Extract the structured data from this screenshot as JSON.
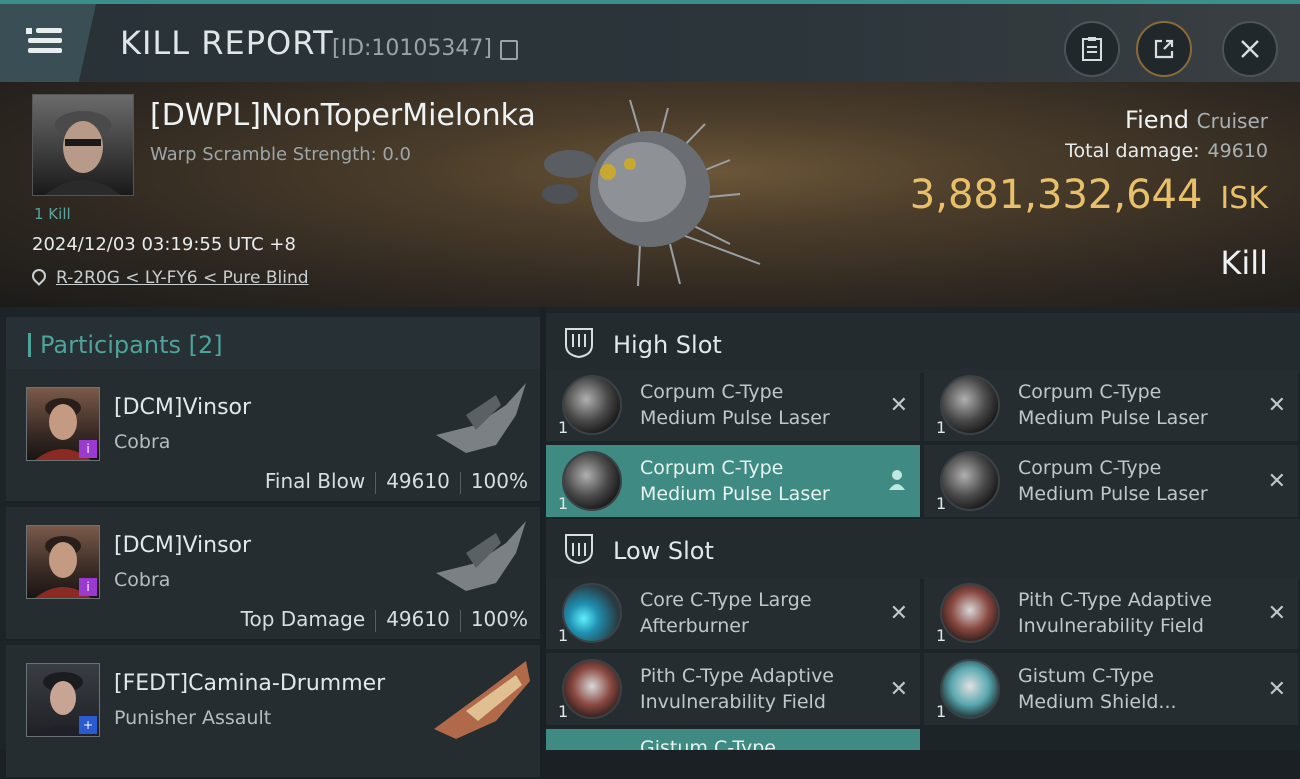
{
  "header": {
    "title": "KILL REPORT",
    "kill_id": "[ID:10105347]",
    "buttons": [
      "clipboard-icon",
      "share-icon",
      "close-icon"
    ]
  },
  "victim": {
    "name": "[DWPL]NonToperMielonka",
    "warp_scramble": "Warp Scramble Strength: 0.0",
    "kills": "1 Kill",
    "timestamp": "2024/12/03 03:19:55 UTC +8",
    "location": "R-2R0G < LY-FY6 < Pure Blind",
    "ship_name": "Fiend",
    "ship_class": "Cruiser",
    "total_damage_label": "Total damage:",
    "total_damage": "49610",
    "isk_value": "3,881,332,644",
    "isk_unit": "ISK",
    "result": "Kill"
  },
  "participants": {
    "header": "Participants [2]",
    "items": [
      {
        "name": "[DCM]Vinsor",
        "ship": "Cobra",
        "role": "Final Blow",
        "damage": "49610",
        "percent": "100%",
        "badge": "i"
      },
      {
        "name": "[DCM]Vinsor",
        "ship": "Cobra",
        "role": "Top Damage",
        "damage": "49610",
        "percent": "100%",
        "badge": "i"
      },
      {
        "name": "[FEDT]Camina-Drummer",
        "ship": "Punisher Assault",
        "badge": "+"
      }
    ]
  },
  "fittings": {
    "high_slot": {
      "label": "High Slot",
      "modules": [
        {
          "line1": "Corpum C-Type",
          "line2": "Medium Pulse Laser",
          "qty": "1"
        },
        {
          "line1": "Corpum C-Type",
          "line2": "Medium Pulse Laser",
          "qty": "1"
        },
        {
          "line1": "Corpum C-Type",
          "line2": "Medium Pulse Laser",
          "qty": "1"
        },
        {
          "line1": "Corpum C-Type",
          "line2": "Medium Pulse Laser",
          "qty": "1"
        }
      ]
    },
    "low_slot": {
      "label": "Low Slot",
      "modules": [
        {
          "line1": "Core C-Type Large",
          "line2": "Afterburner",
          "qty": "1"
        },
        {
          "line1": "Pith C-Type Adaptive",
          "line2": "Invulnerability Field",
          "qty": "1"
        },
        {
          "line1": "Pith C-Type Adaptive",
          "line2": "Invulnerability Field",
          "qty": "1"
        },
        {
          "line1": "Gistum C-Type",
          "line2": "Medium Shield...",
          "qty": "1"
        }
      ]
    },
    "partial_next": "Gistum C-Type"
  },
  "colors": {
    "accent": "#4fa39a",
    "isk": "#e8c06a",
    "selected_row": "#3f8a83"
  }
}
